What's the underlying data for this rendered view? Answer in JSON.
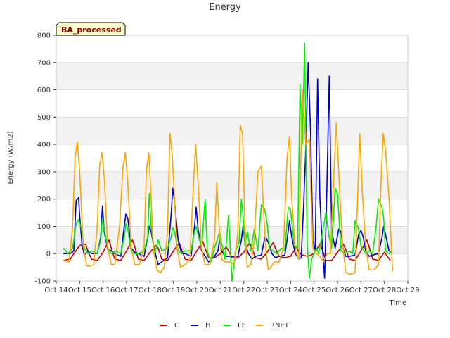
{
  "chart_data": {
    "type": "line",
    "title": "Energy",
    "xlabel": "Time",
    "ylabel": "Energy (W/m2)",
    "badge": "BA_processed",
    "ylim": [
      -100,
      800
    ],
    "yticks": [
      -100,
      0,
      100,
      200,
      300,
      400,
      500,
      600,
      700,
      800
    ],
    "xlim": [
      14,
      29
    ],
    "xticks": [
      14,
      15,
      16,
      17,
      18,
      19,
      20,
      21,
      22,
      23,
      24,
      25,
      26,
      27,
      28,
      29
    ],
    "xtick_labels": [
      "Oct 14",
      "Oct 15",
      "Oct 16",
      "Oct 17",
      "Oct 18",
      "Oct 19",
      "Oct 20",
      "Oct 21",
      "Oct 22",
      "Oct 23",
      "Oct 24",
      "Oct 25",
      "Oct 26",
      "Oct 27",
      "Oct 28",
      "Oct 29"
    ],
    "grid": true,
    "legend_position": "bottom",
    "colors": {
      "G": "#cc0000",
      "H": "#0000cc",
      "LE": "#00ee00",
      "RNET": "#ffa500"
    },
    "series": [
      {
        "name": "G",
        "x": [
          14.3,
          14.6,
          14.75,
          15.0,
          15.25,
          15.35,
          15.5,
          15.75,
          16.0,
          16.25,
          16.35,
          16.5,
          16.75,
          17.0,
          17.25,
          17.35,
          17.5,
          17.75,
          18.0,
          18.25,
          18.35,
          18.5,
          18.75,
          19.0,
          19.25,
          19.35,
          19.5,
          19.75,
          20.0,
          20.25,
          20.35,
          20.5,
          20.75,
          21.0,
          21.25,
          21.35,
          21.5,
          21.75,
          22.0,
          22.25,
          22.35,
          22.5,
          22.75,
          23.0,
          23.25,
          23.35,
          23.5,
          23.75,
          24.0,
          24.25,
          24.35,
          24.5,
          24.75,
          25.0,
          25.25,
          25.35,
          25.5,
          25.75,
          26.0,
          26.25,
          26.35,
          26.5,
          26.75,
          27.0,
          27.25,
          27.35,
          27.5,
          27.75,
          28.0,
          28.25
        ],
        "y": [
          -25,
          -20,
          0,
          30,
          35,
          10,
          -20,
          -25,
          5,
          50,
          20,
          -20,
          -25,
          10,
          50,
          25,
          -20,
          -25,
          5,
          30,
          20,
          -20,
          -25,
          10,
          40,
          15,
          -20,
          -25,
          10,
          45,
          20,
          -15,
          -15,
          0,
          25,
          10,
          -15,
          -15,
          5,
          40,
          20,
          -15,
          -20,
          5,
          40,
          20,
          -10,
          -15,
          -10,
          25,
          5,
          -5,
          -10,
          0,
          35,
          15,
          -25,
          -25,
          5,
          35,
          15,
          -20,
          -25,
          10,
          50,
          25,
          -20,
          -25,
          5,
          -25
        ]
      },
      {
        "name": "H",
        "x": [
          14.3,
          14.6,
          14.75,
          14.85,
          14.95,
          15.0,
          15.1,
          15.2,
          15.35,
          15.5,
          15.75,
          15.9,
          15.97,
          16.05,
          16.2,
          16.35,
          16.5,
          16.75,
          16.9,
          16.97,
          17.05,
          17.2,
          17.35,
          17.5,
          17.75,
          17.9,
          17.97,
          18.05,
          18.2,
          18.35,
          18.5,
          18.75,
          18.9,
          18.97,
          19.05,
          19.2,
          19.35,
          19.5,
          19.75,
          19.9,
          19.97,
          20.05,
          20.2,
          20.35,
          20.5,
          20.75,
          20.9,
          20.97,
          21.05,
          21.2,
          21.35,
          21.5,
          21.75,
          21.9,
          21.97,
          22.05,
          22.2,
          22.35,
          22.5,
          22.75,
          22.9,
          22.97,
          23.05,
          23.2,
          23.35,
          23.5,
          23.75,
          23.85,
          23.95,
          24.05,
          24.2,
          24.35,
          24.45,
          24.55,
          24.65,
          24.75,
          24.85,
          24.95,
          25.05,
          25.15,
          25.25,
          25.35,
          25.45,
          25.55,
          25.65,
          25.75,
          25.9,
          26.05,
          26.15,
          26.25,
          26.35,
          26.5,
          26.75,
          26.9,
          27.0,
          27.1,
          27.2,
          27.35,
          27.5,
          27.75,
          27.9,
          27.97,
          28.05,
          28.2,
          28.35
        ],
        "y": [
          0,
          0,
          10,
          195,
          205,
          140,
          30,
          -5,
          10,
          0,
          0,
          60,
          175,
          80,
          15,
          10,
          0,
          -10,
          100,
          145,
          130,
          20,
          5,
          0,
          -10,
          60,
          100,
          80,
          10,
          -40,
          -30,
          -15,
          140,
          240,
          190,
          50,
          0,
          0,
          -10,
          100,
          170,
          90,
          10,
          -10,
          -30,
          -10,
          10,
          50,
          10,
          -10,
          -10,
          -10,
          -10,
          50,
          100,
          40,
          0,
          -20,
          -10,
          -5,
          60,
          55,
          40,
          0,
          -15,
          -10,
          -5,
          50,
          120,
          60,
          0,
          -20,
          -15,
          170,
          390,
          700,
          450,
          50,
          10,
          640,
          200,
          30,
          -90,
          250,
          650,
          80,
          20,
          90,
          80,
          15,
          -10,
          -10,
          -5,
          70,
          85,
          60,
          10,
          -10,
          -5,
          0,
          60,
          100,
          70,
          10,
          0
        ]
      },
      {
        "name": "LE",
        "x": [
          14.3,
          14.5,
          14.7,
          14.85,
          14.95,
          15.05,
          15.2,
          15.35,
          15.5,
          15.75,
          15.9,
          15.97,
          16.05,
          16.2,
          16.35,
          16.5,
          16.75,
          16.9,
          16.97,
          17.05,
          17.2,
          17.35,
          17.5,
          17.75,
          17.9,
          17.97,
          18.05,
          18.2,
          18.35,
          18.5,
          18.75,
          18.9,
          18.97,
          19.05,
          19.2,
          19.35,
          19.5,
          19.75,
          19.9,
          19.97,
          20.05,
          20.2,
          20.35,
          20.45,
          20.6,
          20.75,
          20.9,
          20.97,
          21.05,
          21.2,
          21.35,
          21.5,
          21.65,
          21.8,
          21.9,
          21.97,
          22.05,
          22.15,
          22.3,
          22.45,
          22.6,
          22.75,
          22.9,
          23.0,
          23.1,
          23.25,
          23.4,
          23.6,
          23.75,
          23.9,
          24.0,
          24.15,
          24.3,
          24.4,
          24.5,
          24.6,
          24.7,
          24.8,
          24.9,
          25.0,
          25.1,
          25.2,
          25.35,
          25.5,
          25.65,
          25.75,
          25.9,
          26.0,
          26.15,
          26.3,
          26.5,
          26.65,
          26.75,
          26.9,
          27.0,
          27.2,
          27.35,
          27.5,
          27.65,
          27.75,
          27.9,
          27.97,
          28.05,
          28.2,
          28.35
        ],
        "y": [
          20,
          0,
          20,
          110,
          125,
          100,
          20,
          0,
          10,
          0,
          50,
          130,
          90,
          20,
          0,
          10,
          0,
          60,
          110,
          90,
          10,
          0,
          0,
          10,
          60,
          220,
          100,
          0,
          50,
          10,
          20,
          60,
          95,
          80,
          10,
          0,
          10,
          10,
          80,
          100,
          70,
          20,
          200,
          5,
          -30,
          20,
          60,
          80,
          40,
          -20,
          140,
          -100,
          10,
          40,
          200,
          140,
          30,
          80,
          10,
          90,
          10,
          180,
          160,
          110,
          20,
          10,
          0,
          20,
          10,
          170,
          160,
          30,
          20,
          620,
          400,
          770,
          50,
          -90,
          -20,
          0,
          20,
          0,
          70,
          150,
          60,
          20,
          240,
          220,
          10,
          0,
          10,
          0,
          120,
          90,
          30,
          0,
          10,
          0,
          100,
          200,
          170,
          130,
          10,
          0,
          10
        ]
      },
      {
        "name": "RNET",
        "x": [
          14.3,
          14.55,
          14.7,
          14.8,
          14.9,
          15.0,
          15.15,
          15.3,
          15.45,
          15.6,
          15.75,
          15.85,
          15.95,
          16.05,
          16.2,
          16.35,
          16.5,
          16.7,
          16.85,
          16.95,
          17.05,
          17.2,
          17.35,
          17.55,
          17.75,
          17.85,
          17.95,
          18.05,
          18.15,
          18.3,
          18.45,
          18.6,
          18.75,
          18.85,
          18.95,
          19.05,
          19.15,
          19.3,
          19.5,
          19.7,
          19.85,
          19.95,
          20.05,
          20.2,
          20.35,
          20.55,
          20.75,
          20.85,
          20.95,
          21.05,
          21.2,
          21.4,
          21.6,
          21.75,
          21.85,
          21.95,
          22.05,
          22.15,
          22.3,
          22.45,
          22.6,
          22.75,
          22.85,
          22.95,
          23.05,
          23.15,
          23.3,
          23.5,
          23.7,
          23.85,
          23.95,
          24.05,
          24.2,
          24.35,
          24.5,
          24.65,
          24.8,
          24.95,
          25.1,
          25.25,
          25.4,
          25.55,
          25.7,
          25.85,
          25.95,
          26.05,
          26.2,
          26.35,
          26.55,
          26.75,
          26.85,
          26.95,
          27.05,
          27.2,
          27.35,
          27.55,
          27.75,
          27.85,
          27.95,
          28.05,
          28.2,
          28.35
        ],
        "y": [
          -25,
          -30,
          100,
          350,
          410,
          300,
          30,
          -45,
          -45,
          -40,
          100,
          320,
          370,
          280,
          20,
          -40,
          -40,
          100,
          320,
          370,
          260,
          20,
          -40,
          -40,
          30,
          310,
          370,
          200,
          10,
          -60,
          -70,
          -50,
          80,
          440,
          360,
          200,
          20,
          -50,
          -40,
          -20,
          250,
          400,
          260,
          20,
          -40,
          -40,
          50,
          260,
          100,
          -20,
          -30,
          -30,
          -40,
          80,
          470,
          440,
          100,
          -50,
          -40,
          50,
          300,
          320,
          150,
          10,
          -60,
          -50,
          -30,
          -30,
          20,
          350,
          430,
          200,
          10,
          -20,
          600,
          400,
          420,
          20,
          0,
          -10,
          -30,
          0,
          0,
          300,
          480,
          300,
          50,
          -70,
          -75,
          -70,
          180,
          440,
          240,
          30,
          -60,
          -60,
          -40,
          250,
          440,
          380,
          200,
          -65
        ]
      }
    ]
  }
}
